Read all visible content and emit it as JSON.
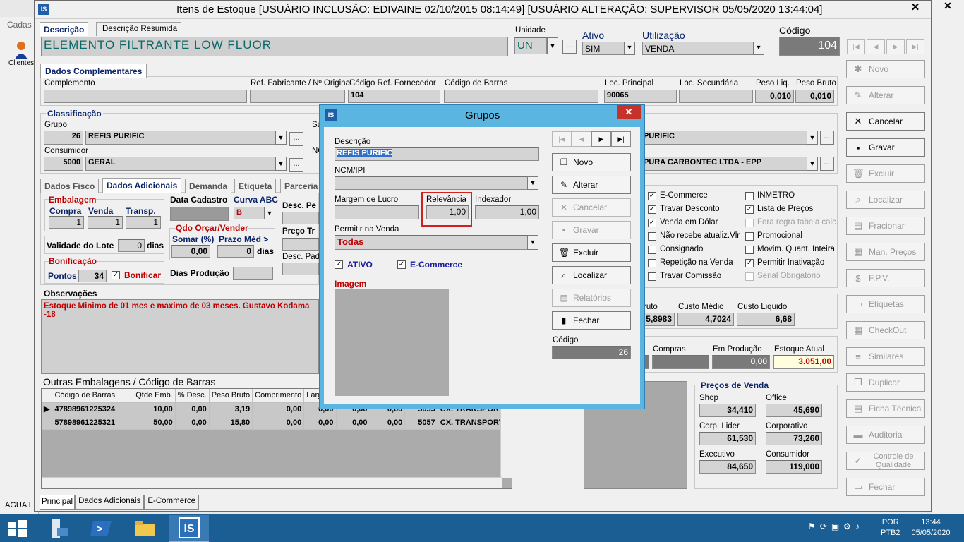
{
  "window": {
    "title": "Itens de Estoque  [USUÁRIO INCLUSÃO: EDIVAINE 02/10/2015 08:14:49]  [USUÁRIO ALTERAÇÃO: SUPERVISOR 05/05/2020 13:44:04]",
    "close": "✕",
    "logo": "IS"
  },
  "bg": {
    "menu": "Cadas",
    "tool": "Clientes",
    "bottom": "AGUA I",
    "close": "✕"
  },
  "main_tabs": [
    "Descrição",
    "Descrição Resumida"
  ],
  "description": "ELEMENTO FILTRANTE  LOW FLUOR",
  "unidade": {
    "label": "Unidade",
    "value": "UN"
  },
  "ativo": {
    "label": "Ativo",
    "value": "SIM"
  },
  "utilizacao": {
    "label": "Utilização",
    "value": "VENDA"
  },
  "codigo": {
    "label": "Código",
    "value": "104"
  },
  "nav": [
    "|◀",
    "◀",
    "▶",
    "▶|"
  ],
  "complementares": {
    "title": "Dados Complementares",
    "complemento": "Complemento",
    "ref_fab": "Ref. Fabricante / Nº Original",
    "cod_ref": "Código Ref. Fornecedor",
    "cod_ref_val": "104",
    "cod_barras": "Código de Barras",
    "loc_principal": "Loc. Principal",
    "loc_principal_val": "90065",
    "loc_sec": "Loc. Secundária",
    "peso_liq": "Peso Liq.",
    "peso_liq_val": "0,010",
    "peso_bruto": "Peso Bruto",
    "peso_bruto_val": "0,010"
  },
  "classificacao": {
    "title": "Classificação",
    "grupo": "Grupo",
    "grupo_cod": "26",
    "grupo_nome": "REFIS PURIFIC",
    "consumidor": "Consumidor",
    "cons_cod": "5000",
    "cons_nome": "GERAL",
    "su": "Su",
    "no": "NC",
    "right1": "PURIFIC",
    "right2": "PURA CARBONTEC LTDA - EPP"
  },
  "detail_tabs": [
    "Dados Fisco",
    "Dados Adicionais",
    "Demanda",
    "Etiqueta",
    "Parceria"
  ],
  "adicionais": {
    "embalagem": "Embalagem",
    "compra": "Compra",
    "compra_val": "1",
    "venda": "Venda",
    "venda_val": "1",
    "transp": "Transp.",
    "transp_val": "1",
    "validade": "Validade do Lote",
    "validade_val": "0",
    "dias": "dias",
    "bonificacao": "Bonificação",
    "pontos": "Pontos",
    "pontos_val": "34",
    "bonificar": "Bonificar",
    "data_cadastro": "Data Cadastro",
    "curva": "Curva ABC",
    "curva_val": "B",
    "qdo": "Qdo Orçar/Vender",
    "somar": "Somar (%)",
    "somar_val": "0,00",
    "prazo": "Prazo Méd >",
    "prazo_val": "0",
    "dias2": "dias",
    "dias_producao": "Dias Produção",
    "desc_pe": "Desc. Pe",
    "preco_tr": "Preço Tr",
    "desc_padr": "Desc. Padr"
  },
  "obs": {
    "title": "Observações",
    "text": "Estoque Minimo de 01 mes e maximo de 03 meses. Gustavo Kodama\n-18"
  },
  "outras": {
    "title": "Outras Embalagens / Código de Barras",
    "headers": [
      "Código de Barras",
      "Qtde Emb.",
      "% Desc.",
      "Peso Bruto",
      "Comprimento",
      "Largur"
    ],
    "rows": [
      {
        "cb": "47898961225324",
        "q": "10,00",
        "d": "0,00",
        "p": "3,19",
        "c": "0,00",
        "l": "0,00",
        "x1": "0,00",
        "x2": "0,00",
        "cod": "5055",
        "emb": "CX. TRANSPORTE"
      },
      {
        "cb": "57898961225321",
        "q": "50,00",
        "d": "0,00",
        "p": "15,80",
        "c": "0,00",
        "l": "0,00",
        "x1": "0,00",
        "x2": "0,00",
        "cod": "5057",
        "emb": "CX. TRANSPORTE"
      }
    ]
  },
  "flags": [
    {
      "label": "E-Commerce",
      "checked": true,
      "disabled": false
    },
    {
      "label": "Travar Desconto",
      "checked": true,
      "disabled": false
    },
    {
      "label": "Venda em Dólar",
      "checked": true,
      "disabled": false
    },
    {
      "label": "Não recebe atualiz.Vlr",
      "checked": false,
      "disabled": false
    },
    {
      "label": "Consignado",
      "checked": false,
      "disabled": false
    },
    {
      "label": "Repetição na Venda",
      "checked": false,
      "disabled": false
    },
    {
      "label": "Travar Comissão",
      "checked": false,
      "disabled": false
    }
  ],
  "flags2": [
    {
      "label": "INMETRO",
      "checked": false,
      "disabled": false
    },
    {
      "label": "Lista de Preços",
      "checked": true,
      "disabled": false
    },
    {
      "label": "Fora regra tabela calc.",
      "checked": false,
      "disabled": true
    },
    {
      "label": "Promocional",
      "checked": false,
      "disabled": false
    },
    {
      "label": "Movim. Quant. Inteira",
      "checked": false,
      "disabled": false
    },
    {
      "label": "Permitir Inativação",
      "checked": true,
      "disabled": false
    },
    {
      "label": "Serial Obrigatório",
      "checked": false,
      "disabled": true
    }
  ],
  "custos": {
    "bruto": "ruto",
    "bruto_val": "5,8983",
    "medio": "Custo Médio",
    "medio_val": "4,7024",
    "liquido": "Custo Liquido",
    "liquido_val": "6,68"
  },
  "estoque": {
    "compras": "Compras",
    "producao": "Em Produção",
    "producao_val": "0,00",
    "atual": "Estoque Atual",
    "atual_val": "3.051,00"
  },
  "precos": {
    "title": "Preços de Venda",
    "items": [
      {
        "label": "Shop",
        "value": "34,410"
      },
      {
        "label": "Office",
        "value": "45,690"
      },
      {
        "label": "Corp. Lider",
        "value": "61,530"
      },
      {
        "label": "Corporativo",
        "value": "73,260"
      },
      {
        "label": "Executivo",
        "value": "84,650"
      },
      {
        "label": "Consumidor",
        "value": "119,000"
      }
    ]
  },
  "side_buttons": [
    {
      "label": "Novo",
      "icon": "✱",
      "enabled": false
    },
    {
      "label": "Alterar",
      "icon": "✎",
      "enabled": false
    },
    {
      "label": "Cancelar",
      "icon": "✕",
      "enabled": true
    },
    {
      "label": "Gravar",
      "icon": "▪",
      "enabled": true
    },
    {
      "label": "Excluir",
      "icon": "🗑",
      "enabled": false
    },
    {
      "label": "Localizar",
      "icon": "⌕",
      "enabled": false
    },
    {
      "label": "Fracionar",
      "icon": "▤",
      "enabled": false
    },
    {
      "label": "Man. Preços",
      "icon": "▦",
      "enabled": false
    },
    {
      "label": "F.P.V.",
      "icon": "$",
      "enabled": false
    },
    {
      "label": "Etiquetas",
      "icon": "▭",
      "enabled": false
    },
    {
      "label": "CheckOut",
      "icon": "▦",
      "enabled": false
    },
    {
      "label": "Similares",
      "icon": "≡",
      "enabled": false
    },
    {
      "label": "Duplicar",
      "icon": "❐",
      "enabled": false
    },
    {
      "label": "Ficha Técnica",
      "icon": "▤",
      "enabled": false
    },
    {
      "label": "Auditoria",
      "icon": "▬",
      "enabled": false
    },
    {
      "label": "Controle de Qualidade",
      "icon": "✓",
      "enabled": false
    },
    {
      "label": "Fechar",
      "icon": "▭",
      "enabled": false
    }
  ],
  "bottom_tabs": [
    "Principal",
    "Dados Adicionais",
    "E-Commerce"
  ],
  "dialog": {
    "title": "Grupos",
    "close": "✕",
    "descricao": "Descrição",
    "descricao_val": "REFIS PURIFIC",
    "ncm": "NCM/IPI",
    "margem": "Margem de Lucro",
    "relevancia": "Relevância",
    "relevancia_val": "1,00",
    "indexador": "Indexador",
    "indexador_val": "1,00",
    "permitir": "Permitir na Venda",
    "permitir_val": "Todas",
    "ativo": "ATIVO",
    "ecommerce": "E-Commerce",
    "imagem": "Imagem",
    "codigo": "Código",
    "codigo_val": "26",
    "buttons": [
      {
        "label": "Novo",
        "icon": "❐",
        "enabled": true
      },
      {
        "label": "Alterar",
        "icon": "✎",
        "enabled": true
      },
      {
        "label": "Cancelar",
        "icon": "✕",
        "enabled": false
      },
      {
        "label": "Gravar",
        "icon": "▪",
        "enabled": false
      },
      {
        "label": "Excluir",
        "icon": "🗑",
        "enabled": true
      },
      {
        "label": "Localizar",
        "icon": "⌕",
        "enabled": true
      },
      {
        "label": "Relatórios",
        "icon": "▤",
        "enabled": false
      },
      {
        "label": "Fechar",
        "icon": "▮",
        "enabled": true
      }
    ],
    "nav": [
      "|◀",
      "◀",
      "▶",
      "▶|"
    ]
  },
  "taskbar": {
    "lang1": "POR",
    "lang2": "PTB2",
    "time": "13:44",
    "date": "05/05/2020",
    "app": "IS"
  }
}
